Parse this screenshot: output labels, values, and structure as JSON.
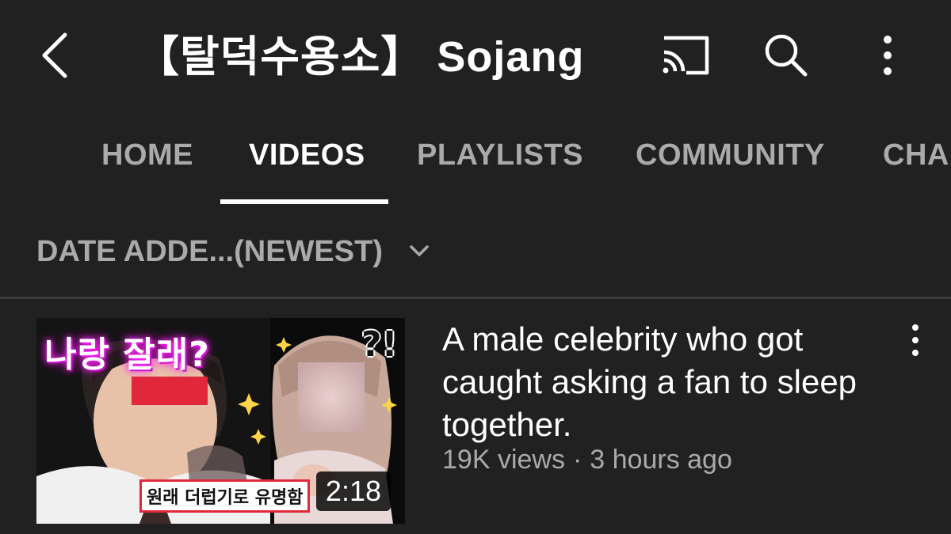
{
  "header": {
    "title": "【탈덕수용소】 Sojang",
    "back_icon": "arrow-back-icon",
    "cast_icon": "cast-icon",
    "search_icon": "search-icon",
    "more_icon": "more-vert-icon"
  },
  "tabs": [
    {
      "label": "HOME",
      "active": false
    },
    {
      "label": "VIDEOS",
      "active": true
    },
    {
      "label": "PLAYLISTS",
      "active": false
    },
    {
      "label": "COMMUNITY",
      "active": false
    },
    {
      "label": "CHANNELS",
      "active": false
    }
  ],
  "sort": {
    "label": "DATE ADDE...(NEWEST)",
    "icon": "chevron-down-icon"
  },
  "videos": [
    {
      "title": "A male celebrity who got caught asking a fan to sleep together.",
      "views": "19K views",
      "separator": "·",
      "age": "3 hours ago",
      "duration": "2:18",
      "thumbnail_text_top": "나랑 잘래?",
      "thumbnail_mark": "?!",
      "thumbnail_caption": "원래 더럽기로 유명함"
    }
  ],
  "colors": {
    "background": "#212121",
    "text_primary": "#ffffff",
    "text_secondary": "#aaaaaa",
    "divider": "#3b3b3b"
  }
}
